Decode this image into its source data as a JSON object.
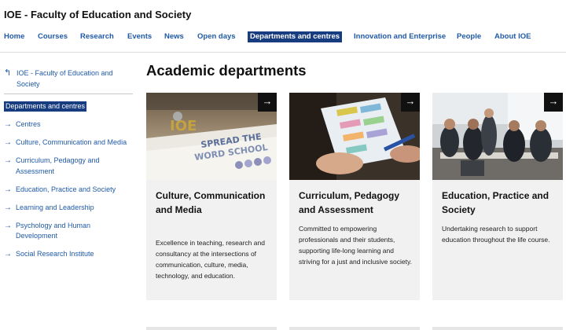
{
  "site": {
    "title": "IOE - Faculty of Education and Society"
  },
  "nav": {
    "items": [
      "Home",
      "Courses",
      "Research",
      "Events",
      "News",
      "Open days",
      "Departments and centres",
      "Innovation and Enterprise",
      "People",
      "About IOE"
    ],
    "active": "Departments and centres"
  },
  "sidebar": {
    "back_label": "IOE - Faculty of Education and Society",
    "active_label": "Departments and centres",
    "items": [
      "Centres",
      "Culture, Communication and Media",
      "Curriculum, Pedagogy and Assessment",
      "Education, Practice and Society",
      "Learning and Leadership",
      "Psychology and Human Development",
      "Social Research Institute"
    ]
  },
  "main": {
    "heading": "Academic departments",
    "cards": [
      {
        "title": "Culture, Communication and Media",
        "description": "Excellence in teaching, research and consultancy at the intersections of communication, culture, media, technology, and education."
      },
      {
        "title": "Curriculum, Pedagogy and Assessment",
        "description": "Committed to empowering professionals and their students, supporting life-long learning and striving for a just and inclusive society."
      },
      {
        "title": "Education, Practice and Society",
        "description": "Undertaking research to support education throughout the life course."
      }
    ]
  },
  "icons": {
    "back": "return-arrow-icon",
    "item_arrow": "right-arrow-icon",
    "card_link": "arrow-right-icon"
  },
  "colors": {
    "link": "#1f5aa8",
    "active_bg": "#173c80",
    "card_bg": "#f1f1f1"
  }
}
